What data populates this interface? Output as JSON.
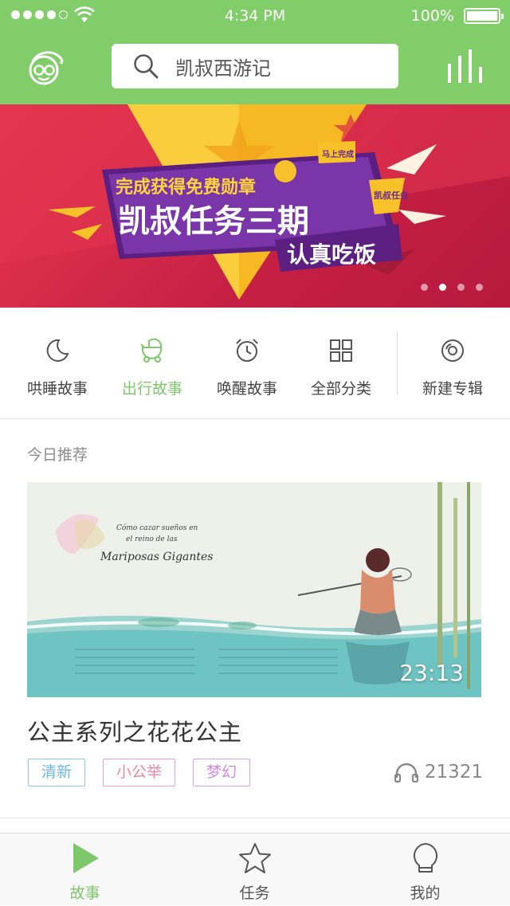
{
  "status_bar": {
    "time": "4:34 PM",
    "battery": "100%"
  },
  "header": {
    "search_text": "凯叔西游记"
  },
  "banner": {
    "line1": "完成获得免费勋章",
    "line2": "凯叔任务三期",
    "line3": "认真吃饭",
    "badge": "马上完成",
    "side_tag": "凯叔任务",
    "page_count": 4,
    "active_page": 1
  },
  "categories": [
    {
      "label": "哄睡故事",
      "icon": "moon-icon"
    },
    {
      "label": "出行故事",
      "icon": "stroller-icon",
      "active": true
    },
    {
      "label": "唤醒故事",
      "icon": "alarm-clock-icon"
    },
    {
      "label": "全部分类",
      "icon": "grid-icon"
    },
    {
      "label": "新建专辑",
      "icon": "disc-icon"
    }
  ],
  "recommend": {
    "section_title": "今日推荐",
    "image_caption_line1": "Cómo cazar sueños en",
    "image_caption_line2": "el reino de las",
    "image_caption_line3": "Mariposas Gigantes",
    "duration": "23:13",
    "title": "公主系列之花花公主",
    "tags": [
      "清新",
      "小公举",
      "梦幻"
    ],
    "play_count": "21321"
  },
  "tabbar": {
    "tabs": [
      {
        "label": "故事",
        "icon": "play-icon",
        "active": true
      },
      {
        "label": "任务",
        "icon": "star-icon"
      },
      {
        "label": "我的",
        "icon": "profile-icon"
      }
    ]
  },
  "colors": {
    "brand": "#81cd6a",
    "active_text": "#7ec76a",
    "banner_red": "#d62a48",
    "banner_yellow": "#f7c12a",
    "banner_purple": "#6a2a8e"
  }
}
